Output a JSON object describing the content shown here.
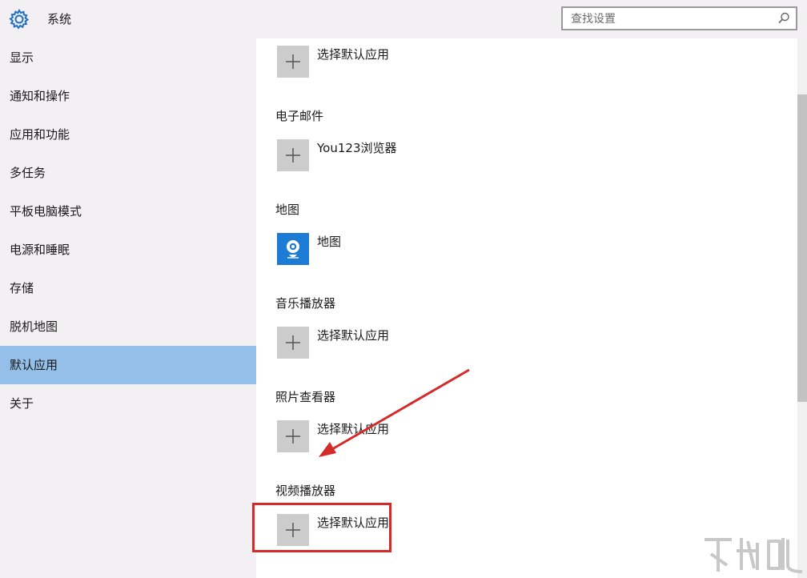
{
  "header": {
    "title": "系统",
    "icon": "gear-icon"
  },
  "search": {
    "placeholder": "查找设置",
    "icon": "search-icon"
  },
  "sidebar": {
    "items": [
      {
        "label": "显示"
      },
      {
        "label": "通知和操作"
      },
      {
        "label": "应用和功能"
      },
      {
        "label": "多任务"
      },
      {
        "label": "平板电脑模式"
      },
      {
        "label": "电源和睡眠"
      },
      {
        "label": "存储"
      },
      {
        "label": "脱机地图"
      },
      {
        "label": "默认应用",
        "selected": true
      },
      {
        "label": "关于"
      }
    ]
  },
  "content": {
    "top_picker": {
      "label": "选择默认应用",
      "icon": "plus-icon"
    },
    "sections": [
      {
        "title": "电子邮件",
        "app": {
          "label": "You123浏览器",
          "icon": "plus-icon"
        }
      },
      {
        "title": "地图",
        "app": {
          "label": "地图",
          "icon": "maps-app-icon"
        }
      },
      {
        "title": "音乐播放器",
        "app": {
          "label": "选择默认应用",
          "icon": "plus-icon"
        }
      },
      {
        "title": "照片查看器",
        "app": {
          "label": "选择默认应用",
          "icon": "plus-icon"
        }
      },
      {
        "title": "视频播放器",
        "app": {
          "label": "选择默认应用",
          "icon": "plus-icon"
        }
      }
    ]
  },
  "annotation": {
    "color": "#d52a2a"
  },
  "colors": {
    "sidebar_bg": "#f2f0f2",
    "selected_bg": "#94bfe9",
    "tile_bg": "#cccccc",
    "maps_tile": "#1c7bd4"
  }
}
